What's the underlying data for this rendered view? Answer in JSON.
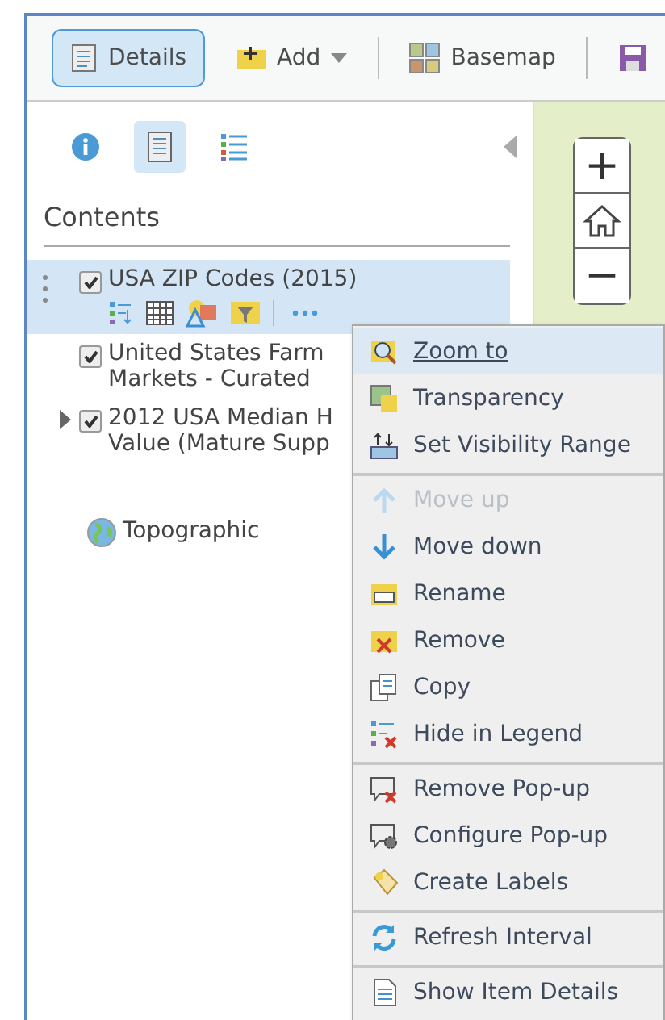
{
  "toolbar": {
    "buttons": [
      {
        "kind": "details",
        "label": "Details",
        "selected": true
      },
      {
        "kind": "add",
        "label": "Add",
        "selected": false
      },
      {
        "kind": "basemap",
        "label": "Basemap",
        "selected": false
      },
      {
        "kind": "save",
        "selected": false
      }
    ]
  },
  "panel_tabs": [
    {
      "kind": "info",
      "selected": false
    },
    {
      "kind": "contents",
      "selected": true
    },
    {
      "kind": "legend",
      "selected": false
    }
  ],
  "contents": {
    "title": "Contents",
    "layers": [
      {
        "kind": "layer",
        "lines": [
          "USA ZIP Codes (2015)"
        ],
        "checked": true,
        "selected": true
      },
      {
        "kind": "layer",
        "lines": [
          "United States Farm",
          "Markets - Curated"
        ],
        "checked": true,
        "selected": false
      },
      {
        "kind": "group",
        "lines": [
          "2012 USA Median H",
          "Value (Mature Supp"
        ],
        "checked": true,
        "selected": false,
        "expanded": false
      },
      {
        "kind": "basemap",
        "lines": [
          "Topographic"
        ],
        "selected": false
      }
    ]
  },
  "menu": {
    "groups": [
      [
        {
          "kind": "zoom",
          "label": "Zoom to",
          "disabled": false,
          "selected": true
        },
        {
          "kind": "transparency",
          "label": "Transparency",
          "disabled": false,
          "selected": false
        },
        {
          "kind": "visibility",
          "label": "Set Visibility Range",
          "disabled": false,
          "selected": false
        }
      ],
      [
        {
          "kind": "up",
          "label": "Move up",
          "disabled": true,
          "selected": false
        },
        {
          "kind": "down",
          "label": "Move down",
          "disabled": false,
          "selected": false
        },
        {
          "kind": "rename",
          "label": "Rename",
          "disabled": false,
          "selected": false
        },
        {
          "kind": "remove",
          "label": "Remove",
          "disabled": false,
          "selected": false
        },
        {
          "kind": "copy",
          "label": "Copy",
          "disabled": false,
          "selected": false
        },
        {
          "kind": "hidelegend",
          "label": "Hide in Legend",
          "disabled": false,
          "selected": false
        }
      ],
      [
        {
          "kind": "removepopup",
          "label": "Remove Pop-up",
          "disabled": false,
          "selected": false
        },
        {
          "kind": "configpopup",
          "label": "Configure Pop-up",
          "disabled": false,
          "selected": false
        },
        {
          "kind": "labels",
          "label": "Create Labels",
          "disabled": false,
          "selected": false
        }
      ],
      [
        {
          "kind": "refresh",
          "label": "Refresh Interval",
          "disabled": false,
          "selected": false
        }
      ],
      [
        {
          "kind": "details",
          "label": "Show Item Details",
          "disabled": false,
          "selected": false
        }
      ]
    ]
  },
  "map_controls": [
    {
      "kind": "zoom-in",
      "label": "+"
    },
    {
      "kind": "home"
    },
    {
      "kind": "zoom-out",
      "label": "−"
    }
  ]
}
